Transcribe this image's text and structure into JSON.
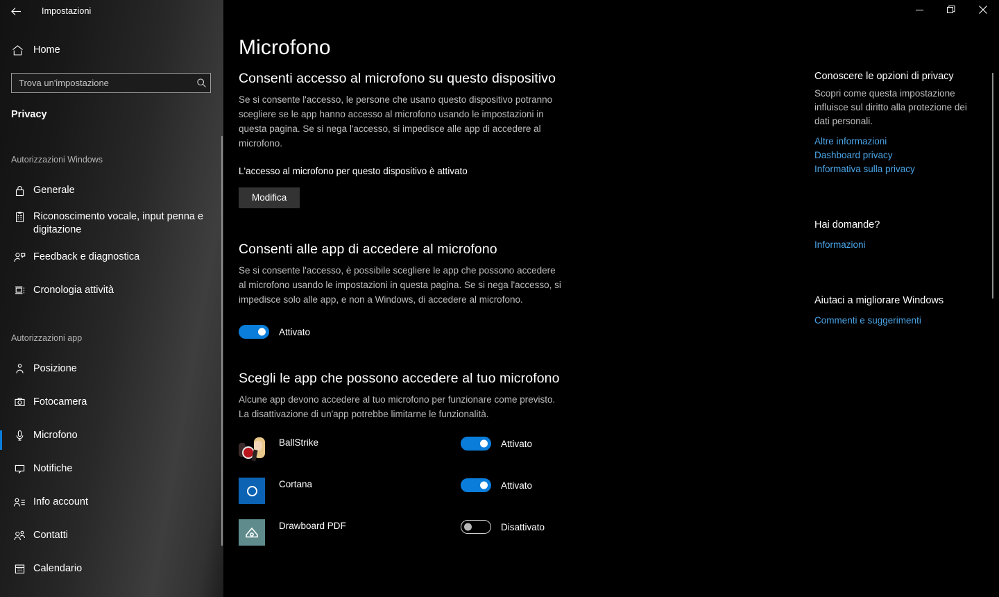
{
  "window": {
    "title": "Impostazioni",
    "back_icon": "back-arrow-icon",
    "minimize_label": "—",
    "maximize_label": "❐",
    "close_label": "✕"
  },
  "sidebar": {
    "home_label": "Home",
    "home_icon": "home-icon",
    "search": {
      "placeholder": "Trova un'impostazione",
      "value": "",
      "icon": "search-icon"
    },
    "section_label": "Privacy",
    "groups": [
      {
        "heading": "Autorizzazioni Windows",
        "items": [
          {
            "label": "Generale",
            "icon": "lock-icon",
            "selected": false
          },
          {
            "label": "Riconoscimento vocale, input penna e digitazione",
            "icon": "clipboard-icon",
            "selected": false
          },
          {
            "label": "Feedback e diagnostica",
            "icon": "feedback-person-icon",
            "selected": false
          },
          {
            "label": "Cronologia attività",
            "icon": "activity-history-icon",
            "selected": false
          }
        ]
      },
      {
        "heading": "Autorizzazioni app",
        "items": [
          {
            "label": "Posizione",
            "icon": "location-pin-icon",
            "selected": false
          },
          {
            "label": "Fotocamera",
            "icon": "camera-icon",
            "selected": false
          },
          {
            "label": "Microfono",
            "icon": "microphone-icon",
            "selected": true
          },
          {
            "label": "Notifiche",
            "icon": "notification-bubble-icon",
            "selected": false
          },
          {
            "label": "Info account",
            "icon": "account-info-icon",
            "selected": false
          },
          {
            "label": "Contatti",
            "icon": "contacts-icon",
            "selected": false
          },
          {
            "label": "Calendario",
            "icon": "calendar-icon",
            "selected": false
          }
        ]
      }
    ]
  },
  "main": {
    "page_title": "Microfono",
    "device_section": {
      "title": "Consenti accesso al microfono su questo dispositivo",
      "body": "Se si consente l'accesso, le persone che usano questo dispositivo potranno scegliere se le app hanno accesso al microfono usando le impostazioni in questa pagina. Se si nega l'accesso, si impedisce alle app di accedere al microfono.",
      "status": "L'accesso al microfono per questo dispositivo è attivato",
      "button_label": "Modifica"
    },
    "apps_access_section": {
      "title": "Consenti alle app di accedere al microfono",
      "body": "Se si consente l'accesso, è possibile scegliere le app che possono accedere al microfono usando le impostazioni in questa pagina. Se si nega l'accesso, si impedisce solo alle app, e non a Windows, di accedere al microfono.",
      "toggle_state": "on",
      "toggle_label": "Attivato"
    },
    "choose_apps_section": {
      "title": "Scegli le app che possono accedere al tuo microfono",
      "body": "Alcune app devono accedere al tuo microfono per funzionare come previsto. La disattivazione di un'app potrebbe limitarne le funzionalità.",
      "apps": [
        {
          "name": "BallStrike",
          "icon": "ballstrike-app-icon",
          "toggle_state": "on",
          "toggle_label": "Attivato"
        },
        {
          "name": "Cortana",
          "icon": "cortana-app-icon",
          "toggle_state": "on",
          "toggle_label": "Attivato"
        },
        {
          "name": "Drawboard PDF",
          "icon": "drawboard-pdf-app-icon",
          "toggle_state": "off",
          "toggle_label": "Disattivato"
        }
      ]
    }
  },
  "aside": {
    "privacy_block": {
      "heading": "Conoscere le opzioni di privacy",
      "body": "Scopri come questa impostazione influisce sul diritto alla protezione dei dati personali.",
      "links": [
        "Altre informazioni",
        "Dashboard privacy",
        "Informativa sulla privacy"
      ]
    },
    "questions_block": {
      "heading": "Hai domande?",
      "links": [
        "Informazioni"
      ]
    },
    "improve_block": {
      "heading": "Aiutaci a migliorare Windows",
      "links": [
        "Commenti e suggerimenti"
      ]
    }
  },
  "colors": {
    "accent": "#0a7ddb",
    "link": "#4aa5e8",
    "background": "#000000",
    "button": "#333333"
  }
}
